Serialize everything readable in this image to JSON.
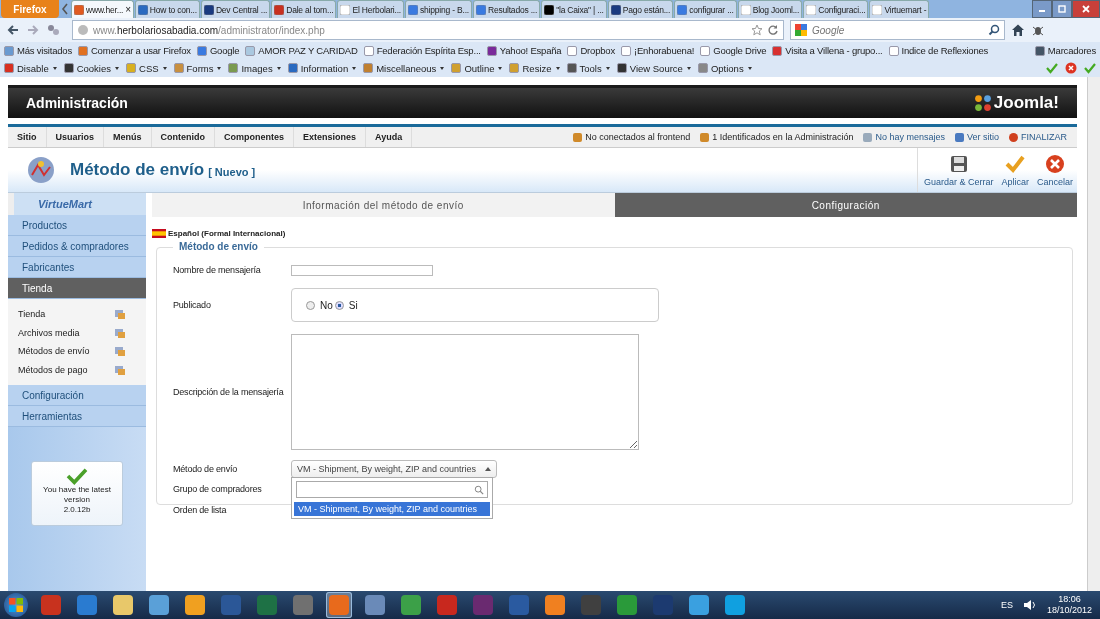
{
  "browser": {
    "menu_button": "Firefox",
    "tabs": [
      {
        "title": "www.her...",
        "selected": true,
        "close": "×"
      },
      {
        "title": "How to con...",
        "selected": false
      },
      {
        "title": "Dev Central ...",
        "selected": false
      },
      {
        "title": "Dale al tom...",
        "selected": false
      },
      {
        "title": "El Herbolari...",
        "selected": false
      },
      {
        "title": "shipping - B...",
        "selected": false
      },
      {
        "title": "Resultados ...",
        "selected": false
      },
      {
        "title": "\"la Caixa\" | ...",
        "selected": false
      },
      {
        "title": "Pago están...",
        "selected": false
      },
      {
        "title": "configurar ...",
        "selected": false
      },
      {
        "title": "Blog Jooml...",
        "selected": false
      },
      {
        "title": "Configuraci...",
        "selected": false
      },
      {
        "title": "Virtuemart -",
        "selected": false
      }
    ],
    "url": "www.**herbolariosabadia.com**/administrator/index.php",
    "search_placeholder": "Google",
    "bookmarks": [
      "Más visitados",
      "Comenzar a usar Firefox",
      "Google",
      "AMOR PAZ Y CARIDAD",
      "Federación Espírita Esp...",
      "Yahoo! España",
      "Dropbox",
      "¡Enhorabuena!",
      "Google Drive",
      "Visita a Villena - grupo...",
      "Indice de Reflexiones"
    ],
    "bookmarks_menu": "Marcadores",
    "addon_menus": [
      "Disable",
      "Cookies",
      "CSS",
      "Forms",
      "Images",
      "Information",
      "Miscellaneous",
      "Outline",
      "Resize",
      "Tools",
      "View Source",
      "Options"
    ]
  },
  "admin": {
    "header": "Administración",
    "logo": "Joomla!",
    "menu": [
      "Sitio",
      "Usuarios",
      "Menús",
      "Contenido",
      "Componentes",
      "Extensiones",
      "Ayuda"
    ],
    "status": [
      {
        "kind": "users",
        "text": "No conectados al frontend"
      },
      {
        "kind": "users",
        "text": "1 Identificados en la Administración"
      },
      {
        "kind": "mail",
        "text": "No hay mensajes"
      },
      {
        "kind": "screen",
        "text": "Ver sitio"
      },
      {
        "kind": "logout",
        "text": "FINALIZAR"
      }
    ],
    "title": "Método de envío",
    "title_tag": "[ Nuevo ]",
    "toolbar": [
      {
        "kind": "save",
        "label": "Guardar & Cerrar"
      },
      {
        "kind": "apply",
        "label": "Aplicar"
      },
      {
        "kind": "cancel",
        "label": "Cancelar"
      }
    ]
  },
  "sidebar": {
    "logo": "VirtueMart",
    "items": [
      {
        "label": "Productos",
        "selected": false
      },
      {
        "label": "Pedidos & compradores",
        "selected": false
      },
      {
        "label": "Fabricantes",
        "selected": false
      },
      {
        "label": "Tienda",
        "selected": true,
        "expanded": true,
        "children": [
          {
            "label": "Tienda"
          },
          {
            "label": "Archivos media"
          },
          {
            "label": "Métodos de envío"
          },
          {
            "label": "Métodos de pago"
          }
        ]
      },
      {
        "label": "Configuración",
        "selected": false
      },
      {
        "label": "Herramientas",
        "selected": false
      }
    ],
    "version_box": {
      "text": "You have the latest version",
      "version": "2.0.12b"
    }
  },
  "tabs": [
    {
      "label": "Información del método de envío",
      "selected": true
    },
    {
      "label": "Configuración",
      "selected": false
    }
  ],
  "language": "Español (Formal Internacional)",
  "fieldset": {
    "legend": "Método de envío",
    "fields": [
      {
        "kind": "text",
        "label": "Nombre de mensajería"
      },
      {
        "kind": "radio",
        "label": "Publicado",
        "options": [
          {
            "label": "No",
            "selected": false
          },
          {
            "label": "Si",
            "selected": true
          }
        ]
      },
      {
        "kind": "textarea",
        "label": "Descripción de la mensajería"
      },
      {
        "kind": "select",
        "label": "Método de envío",
        "value": "VM - Shipment, By weight, ZIP and countries",
        "expanded": true,
        "options": [
          {
            "label": "VM - Shipment, By weight, ZIP and countries",
            "selected": true
          }
        ]
      },
      {
        "kind": "hidden",
        "label": "Grupo de compradores"
      },
      {
        "kind": "hidden",
        "label": "Orden de lista"
      }
    ]
  },
  "taskbar": {
    "apps": [
      {
        "color": "#c8321e",
        "selected": false
      },
      {
        "color": "#2a7bd0",
        "selected": false
      },
      {
        "color": "#e8c86a",
        "selected": false
      },
      {
        "color": "#5aa0d8",
        "selected": false
      },
      {
        "color": "#f0a020",
        "selected": false
      },
      {
        "color": "#2b5797",
        "selected": false
      },
      {
        "color": "#1e7145",
        "selected": false
      },
      {
        "color": "#707070",
        "selected": false
      },
      {
        "color": "#e86a1c",
        "selected": true
      },
      {
        "color": "#6a8ab8",
        "selected": false
      },
      {
        "color": "#3ca048",
        "selected": false
      },
      {
        "color": "#c8281e",
        "selected": false
      },
      {
        "color": "#6a2a70",
        "selected": false
      },
      {
        "color": "#2a5aa0",
        "selected": false
      },
      {
        "color": "#f08020",
        "selected": false
      },
      {
        "color": "#404040",
        "selected": false
      },
      {
        "color": "#2a9a3a",
        "selected": false
      },
      {
        "color": "#1c3a70",
        "selected": false
      },
      {
        "color": "#3aa0e0",
        "selected": false
      },
      {
        "color": "#10a0e0",
        "selected": false
      }
    ],
    "language": "ES",
    "time": "18:06",
    "date": "18/10/2012"
  }
}
